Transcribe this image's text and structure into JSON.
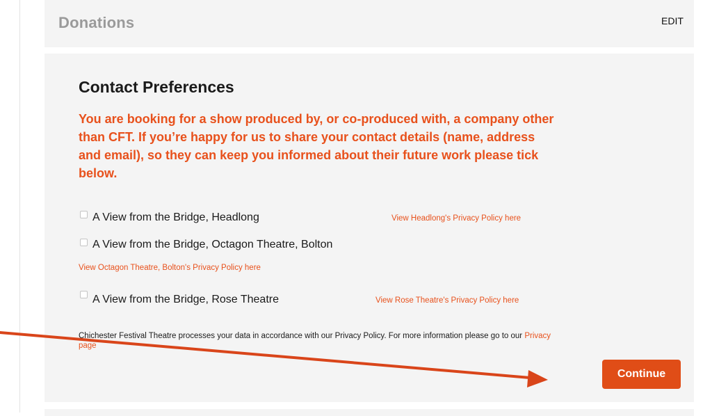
{
  "donations": {
    "title": "Donations",
    "edit_label": "EDIT"
  },
  "contact": {
    "title": "Contact Preferences",
    "notice": "You are booking for a show produced by, or co-produced with, a company other than CFT. If you’re happy for us to share your contact details (name, address and email), so they can keep you informed about their future work please tick below.",
    "items": [
      {
        "label": "A View from the Bridge, Headlong",
        "checked": false,
        "policy_link": "View Headlong's Privacy Policy here"
      },
      {
        "label": "A View from the Bridge, Octagon Theatre, Bolton",
        "checked": false,
        "policy_link": "View Octagon Theatre, Bolton's Privacy Policy here"
      },
      {
        "label": "A View from the Bridge, Rose Theatre",
        "checked": false,
        "policy_link": "View Rose Theatre's Privacy Policy here"
      }
    ],
    "footnote_text": "Chichester Festival Theatre processes your data in accordance with our Privacy Policy. For more information please go to our ",
    "footnote_link": "Privacy page",
    "continue_label": "Continue"
  },
  "colors": {
    "accent": "#e8511c",
    "button": "#e04d17",
    "panel": "#f4f4f4",
    "annotation_arrow": "#d9451a"
  }
}
